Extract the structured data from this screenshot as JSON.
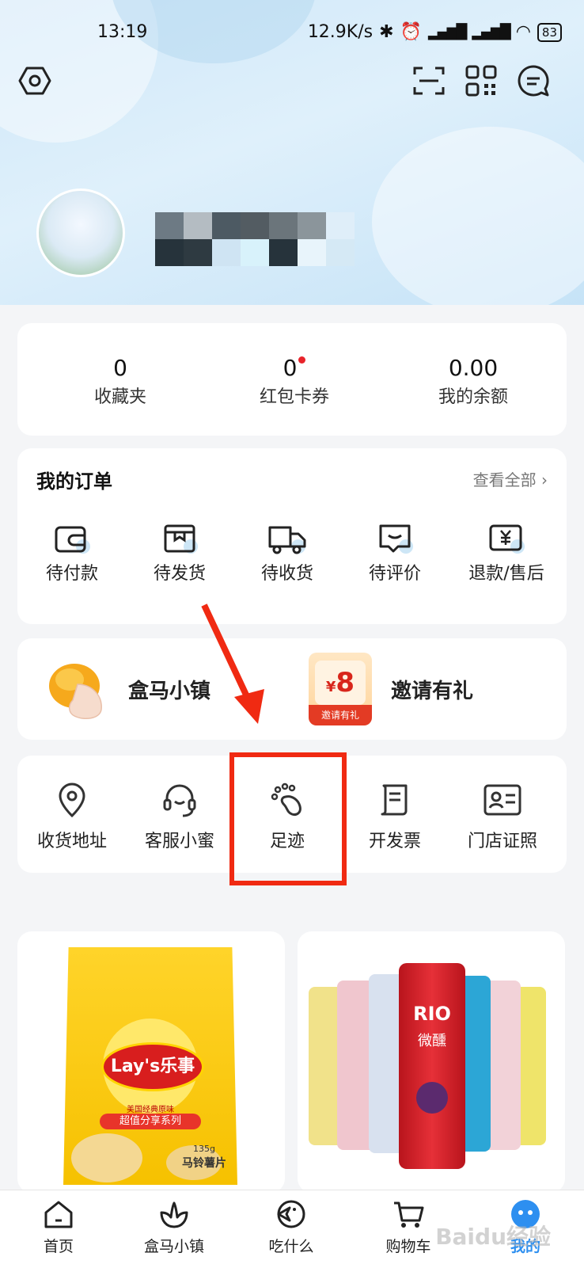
{
  "status_bar": {
    "time": "13:19",
    "net_speed": "12.9K/s",
    "battery": "83"
  },
  "stats": [
    {
      "value": "0",
      "label": "收藏夹"
    },
    {
      "value": "0",
      "label": "红包卡券"
    },
    {
      "value": "0.00",
      "label": "我的余额"
    }
  ],
  "orders": {
    "title": "我的订单",
    "view_all": "查看全部",
    "items": [
      {
        "label": "待付款",
        "icon": "wallet-icon"
      },
      {
        "label": "待发货",
        "icon": "box-icon"
      },
      {
        "label": "待收货",
        "icon": "truck-icon"
      },
      {
        "label": "待评价",
        "icon": "comment-icon"
      },
      {
        "label": "退款/售后",
        "icon": "refund-icon"
      }
    ]
  },
  "promo": {
    "town_label": "盒马小镇",
    "invite_label": "邀请有礼",
    "invite_amount": "8",
    "invite_currency": "¥",
    "invite_badge": "邀请有礼"
  },
  "tools": [
    {
      "label": "收货地址",
      "icon": "location-pin-icon"
    },
    {
      "label": "客服小蜜",
      "icon": "headset-icon"
    },
    {
      "label": "足迹",
      "icon": "footprint-icon"
    },
    {
      "label": "开发票",
      "icon": "invoice-icon"
    },
    {
      "label": "门店证照",
      "icon": "license-icon"
    }
  ],
  "products": [
    {
      "brand": "Lay's乐事",
      "tagline": "超值分享系列",
      "flavor": "美国经典原味",
      "weight": "135g",
      "type": "马铃薯片"
    },
    {
      "brand": "RIO",
      "sub": "微醺"
    }
  ],
  "tabbar": [
    {
      "label": "首页",
      "icon": "home-icon"
    },
    {
      "label": "盒马小镇",
      "icon": "tulip-icon"
    },
    {
      "label": "吃什么",
      "icon": "eat-icon"
    },
    {
      "label": "购物车",
      "icon": "cart-icon"
    },
    {
      "label": "我的",
      "icon": "profile-icon"
    }
  ],
  "watermark": "Baidu经验",
  "colors": {
    "accent_red": "#e8232a",
    "highlight_red": "#f02a12",
    "hero_blue": "#cfe7f8"
  }
}
